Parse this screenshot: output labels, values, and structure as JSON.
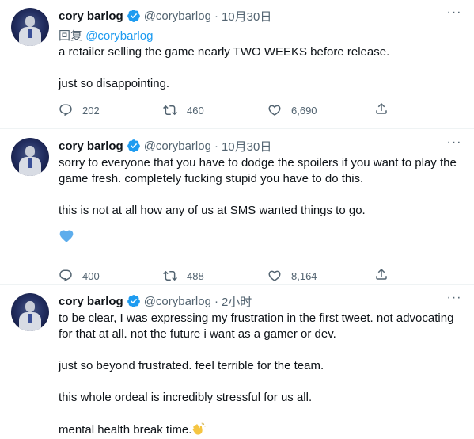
{
  "tweets": [
    {
      "name": "cory barlog",
      "handle": "@corybarlog",
      "separator": "·",
      "time": "10月30日",
      "reply_prefix": "回复",
      "reply_mention": "@corybarlog",
      "paragraphs": [
        "a retailer selling the game nearly TWO WEEKS before release.",
        "just so disappointing."
      ],
      "replies": "202",
      "retweets": "460",
      "likes": "6,690"
    },
    {
      "name": "cory barlog",
      "handle": "@corybarlog",
      "separator": "·",
      "time": "10月30日",
      "paragraphs": [
        "sorry to everyone that you have to dodge the spoilers if you want to play the game fresh. completely fucking stupid you have to do this.",
        "this is not at all how any of us at SMS wanted things to go."
      ],
      "emoji": "blue-heart-icon",
      "replies": "400",
      "retweets": "488",
      "likes": "8,164"
    },
    {
      "name": "cory barlog",
      "handle": "@corybarlog",
      "separator": "·",
      "time": "2小时",
      "paragraphs": [
        "to be clear, I was expressing my frustration in the first tweet. not advocating for that at all. not the future i want as a gamer or dev.",
        "just so beyond frustrated. feel terrible for the team.",
        "this whole ordeal is incredibly stressful for us all.",
        "mental health break time."
      ],
      "emoji": "waving-hand-icon"
    }
  ],
  "colors": {
    "accent": "#1d9bf0",
    "muted": "#536471",
    "text": "#0f1419",
    "divider": "#eff3f4"
  }
}
